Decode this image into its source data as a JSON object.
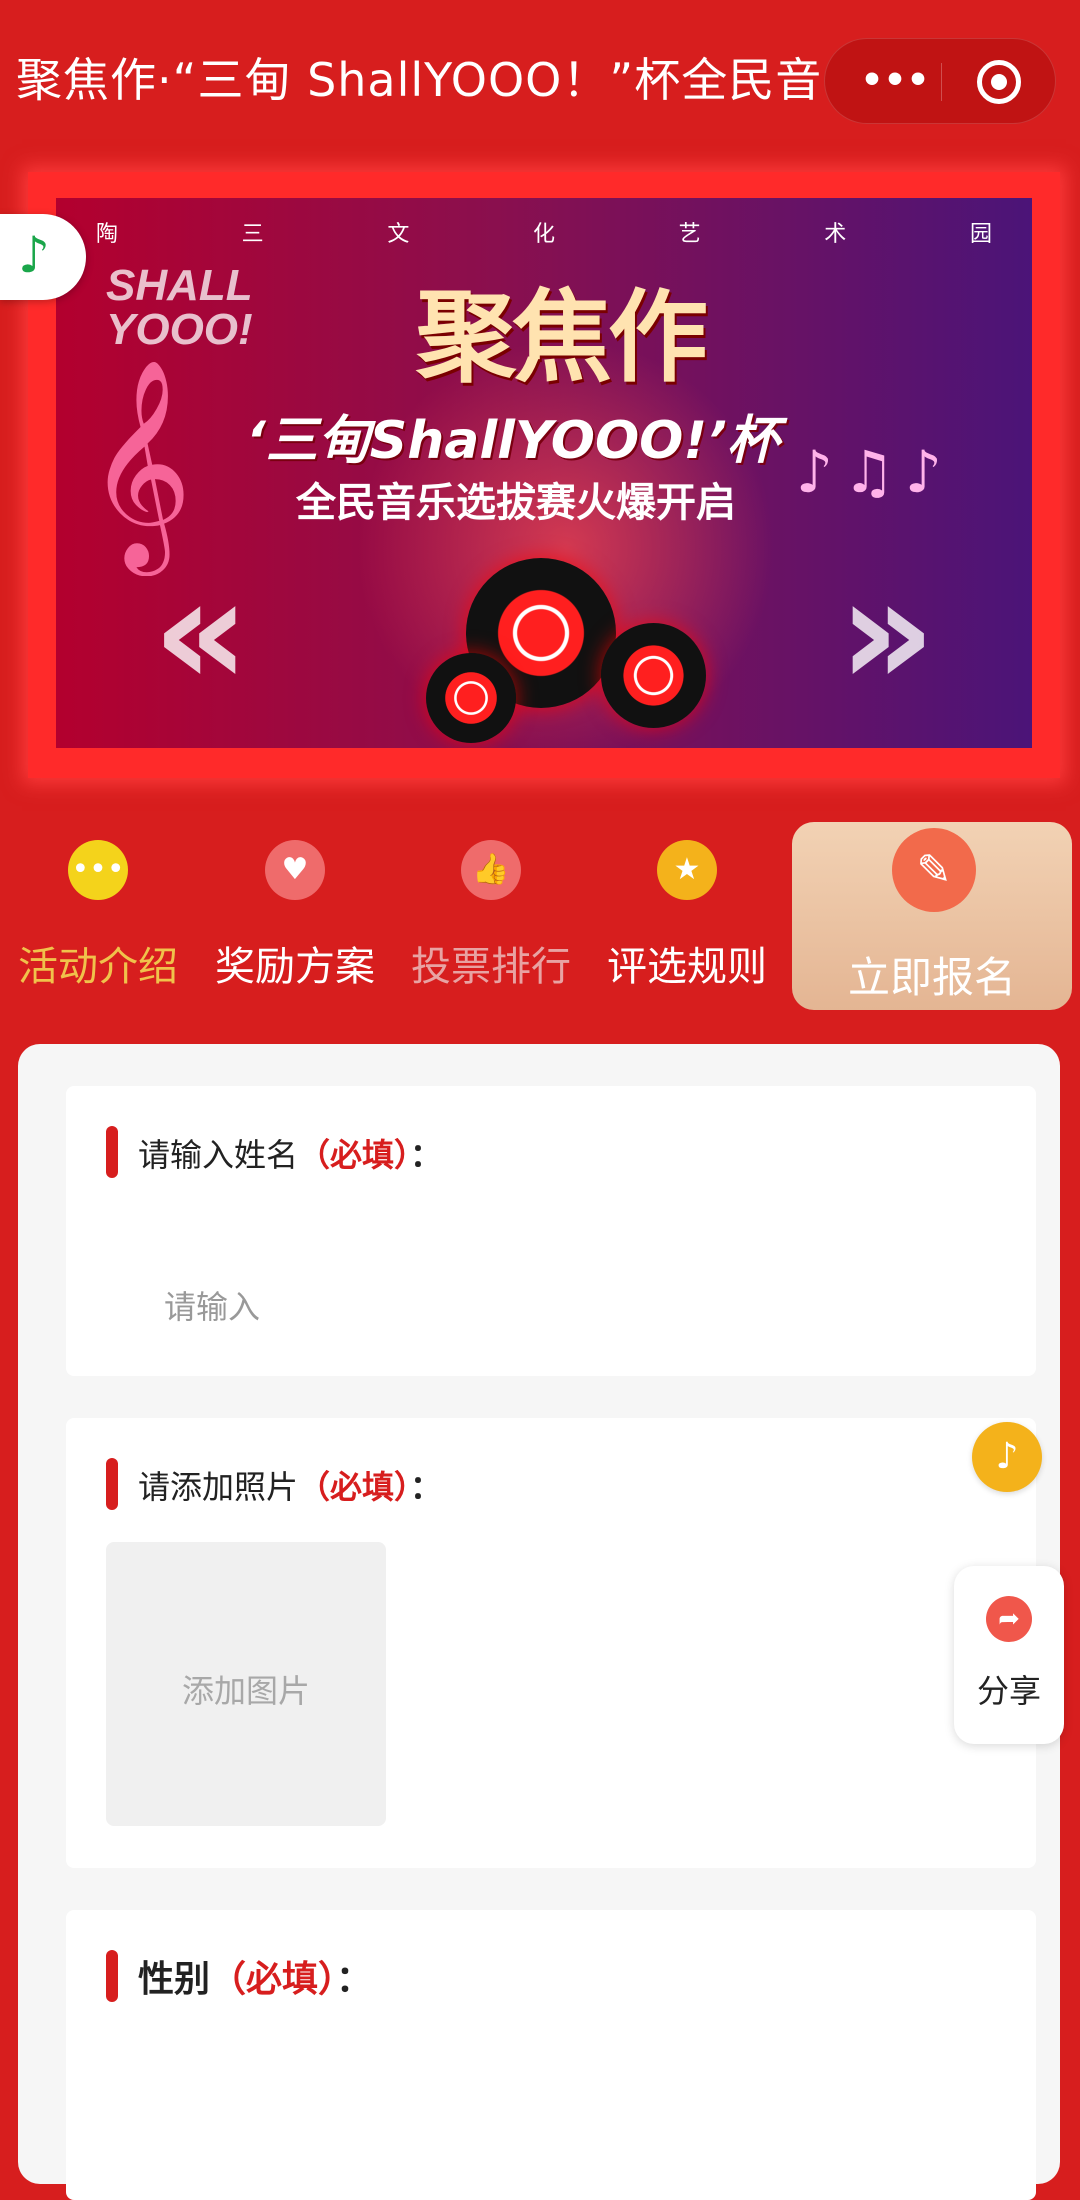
{
  "header": {
    "title": "聚焦作·“三甸 ShallYOOO！”杯全民音",
    "more_icon": "more-dots-icon",
    "close_icon": "target-close-icon"
  },
  "banner": {
    "venue_chars": [
      "陶",
      "三",
      "文",
      "化",
      "艺",
      "术",
      "园"
    ],
    "logo": "SHALL YOOO!",
    "headline": "聚焦作",
    "subline": "‘三甸ShallYOOO!’杯",
    "subline2_prefix": "全民音乐选拔赛",
    "subline2_highlight": "火爆开启"
  },
  "nav": {
    "items": [
      {
        "label": "活动介绍",
        "icon": "chat-bubble-icon",
        "color": "#f4d31b",
        "text_color": "#f0c24b"
      },
      {
        "label": "奖励方案",
        "icon": "heart-icon",
        "color": "#ef6b6b",
        "text_color": "#ffffff"
      },
      {
        "label": "投票排行",
        "icon": "thumbs-up-icon",
        "color": "#ef6b6b",
        "text_color": "#e8a3a3"
      },
      {
        "label": "评选规则",
        "icon": "star-icon",
        "color": "#f4b21b",
        "text_color": "#ffffff"
      }
    ],
    "register": {
      "label": "立即报名",
      "icon": "edit-icon"
    }
  },
  "form": {
    "name_field": {
      "label": "请输入姓名",
      "required": "（必填）",
      "colon": "：",
      "placeholder": "请输入",
      "value": ""
    },
    "photo_field": {
      "label": "请添加照片",
      "required": "（必填）",
      "colon": "：",
      "add_label": "添加图片"
    },
    "gender_field": {
      "label": "性别",
      "required": "（必填）",
      "colon": "："
    }
  },
  "floating": {
    "music_icon": "music-note-icon",
    "share_label": "分享",
    "share_icon": "share-arrow-icon"
  },
  "colors": {
    "brand_red": "#d71e1e",
    "card_bg": "#ffffff",
    "form_bg": "#f6f6f6"
  }
}
